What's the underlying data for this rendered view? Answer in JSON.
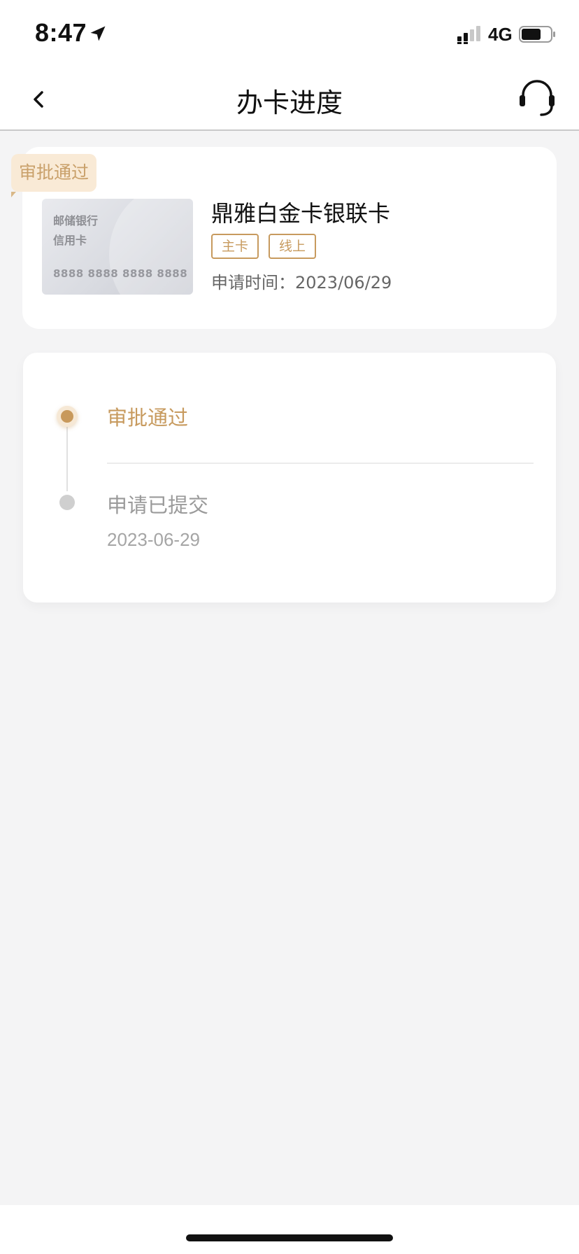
{
  "status_bar": {
    "time": "8:47",
    "network": "4G"
  },
  "nav": {
    "title": "办卡进度"
  },
  "card": {
    "status_tag": "审批通过",
    "image": {
      "bank": "邮储银行",
      "type": "信用卡",
      "number": "8888 8888 8888 8888"
    },
    "name": "鼎雅白金卡银联卡",
    "tags": [
      "主卡",
      "线上"
    ],
    "apply_time": "申请时间：2023/06/29"
  },
  "timeline": {
    "steps": [
      {
        "label": "审批通过",
        "date": ""
      },
      {
        "label": "申请已提交",
        "date": "2023-06-29"
      }
    ]
  },
  "colors": {
    "accent": "#c79a5e",
    "tag_bg": "#f9ead6",
    "page_bg": "#f4f4f5"
  }
}
